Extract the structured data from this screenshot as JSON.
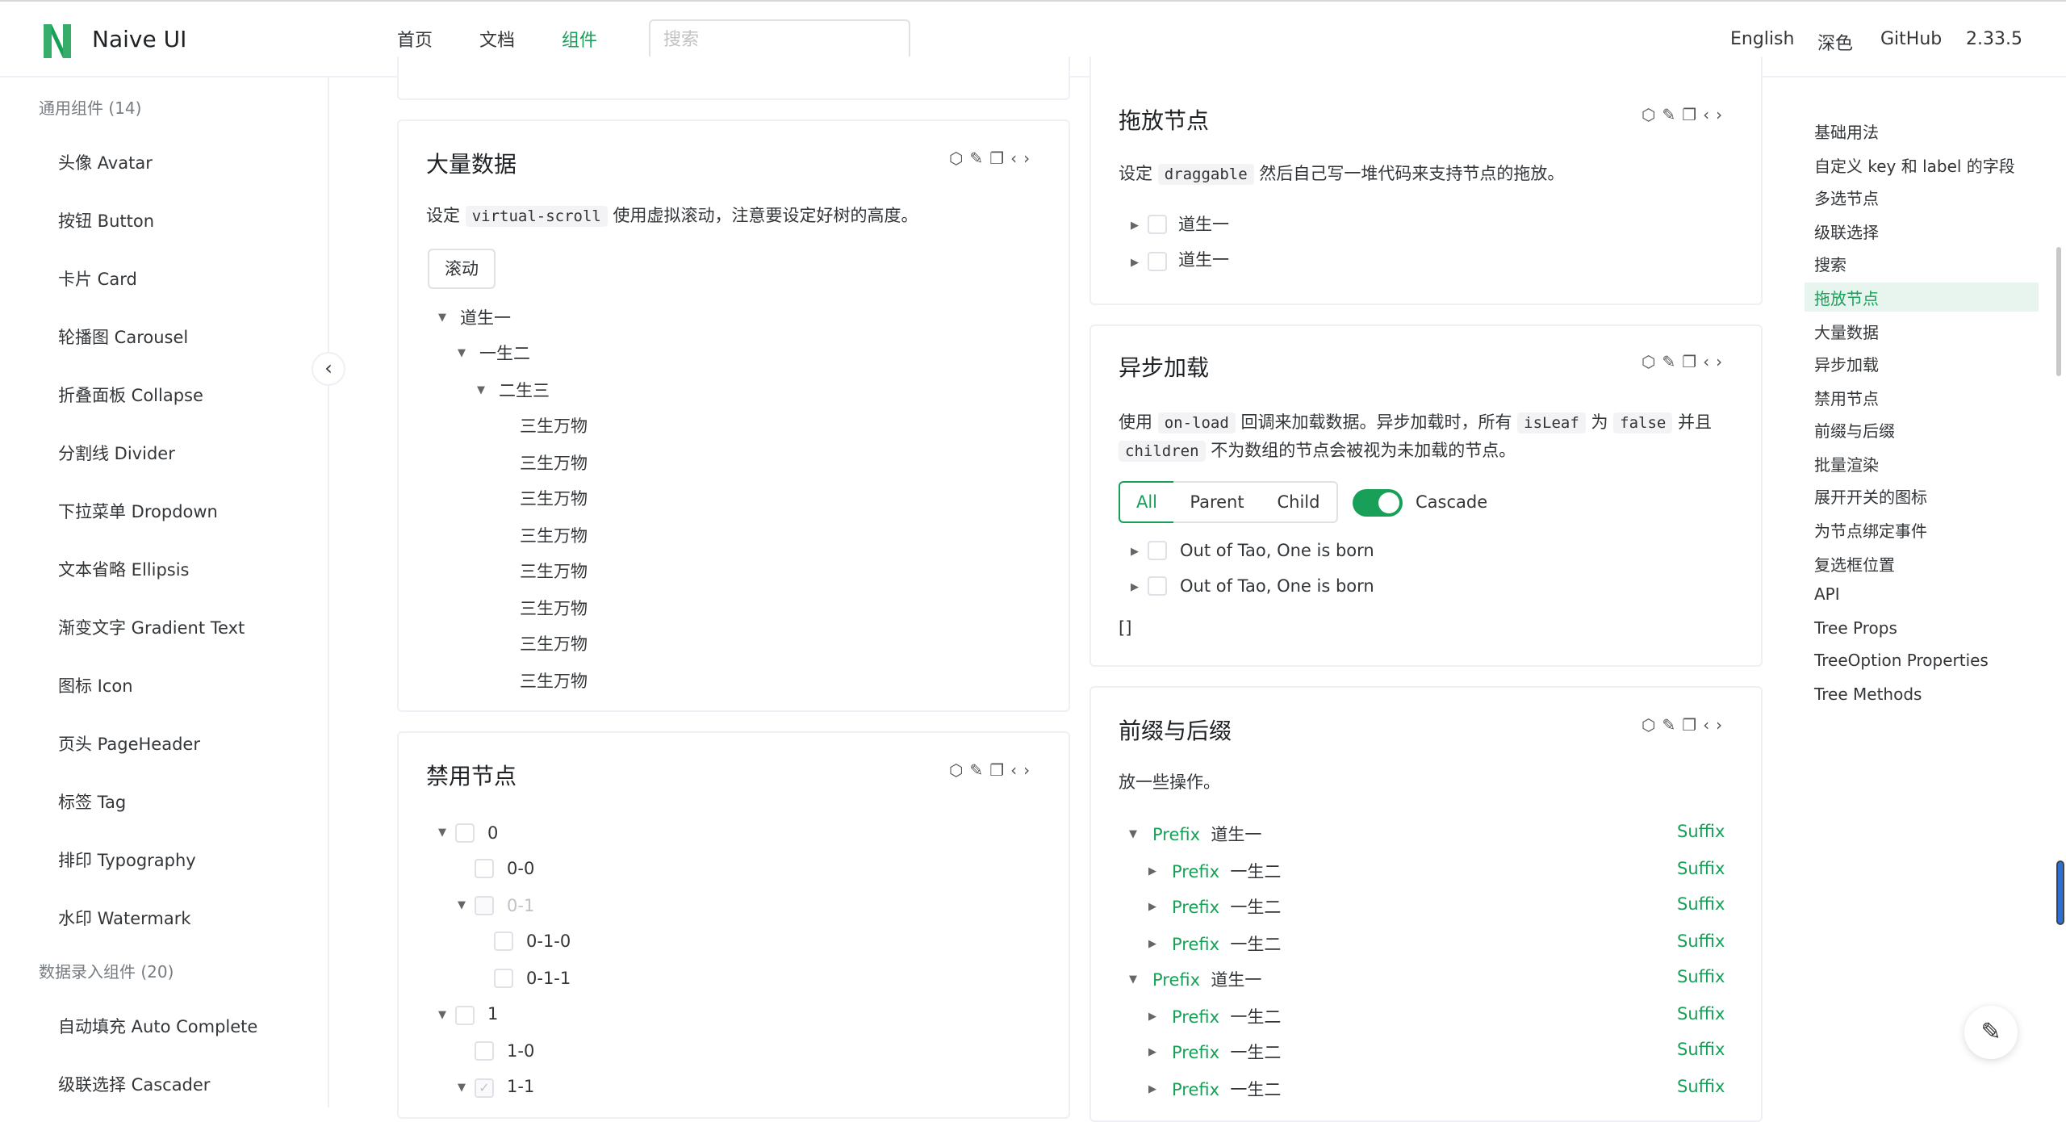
{
  "header": {
    "brand": "Naive UI",
    "nav": [
      "首页",
      "文档",
      "组件"
    ],
    "active_nav": "组件",
    "search_placeholder": "搜索",
    "right": [
      "English",
      "深色",
      "GitHub",
      "2.33.5"
    ]
  },
  "sidebar": {
    "group1": "通用组件 (14)",
    "items1": [
      "头像 Avatar",
      "按钮 Button",
      "卡片 Card",
      "轮播图 Carousel",
      "折叠面板 Collapse",
      "分割线 Divider",
      "下拉菜单 Dropdown",
      "文本省略 Ellipsis",
      "渐变文字 Gradient Text",
      "图标 Icon",
      "页头 PageHeader",
      "标签 Tag",
      "排印 Typography",
      "水印 Watermark"
    ],
    "group2": "数据录入组件 (20)",
    "items2": [
      "自动填充 Auto Complete",
      "级联选择 Cascader"
    ]
  },
  "big_data": {
    "title": "大量数据",
    "desc_prefix": "设定",
    "desc_code": "virtual-scroll",
    "desc_suffix": "使用虚拟滚动，注意要设定好树的高度。",
    "button": "滚动",
    "tree": [
      "道生一",
      "一生二",
      "二生三",
      "三生万物",
      "三生万物",
      "三生万物",
      "三生万物",
      "三生万物",
      "三生万物",
      "三生万物",
      "三生万物"
    ]
  },
  "disabled": {
    "title": "禁用节点",
    "tree": [
      "0",
      "0-0",
      "0-1",
      "0-1-0",
      "0-1-1",
      "1",
      "1-0",
      "1-1"
    ]
  },
  "drag": {
    "title": "拖放节点",
    "desc_prefix": "设定",
    "desc_code": "draggable",
    "desc_suffix": "然后自己写一堆代码来支持节点的拖放。",
    "tree": [
      "道生一",
      "道生一"
    ]
  },
  "async": {
    "title": "异步加载",
    "desc_1": "使用",
    "code_1": "on-load",
    "desc_2": "回调来加载数据。异步加载时，所有",
    "code_2": "isLeaf",
    "desc_3": "为",
    "code_3": "false",
    "desc_4": "并且",
    "code_4": "children",
    "desc_5": "不为数组的节点会被视为未加载的节点。",
    "segments": [
      "All",
      "Parent",
      "Child"
    ],
    "cascade_label": "Cascade",
    "tree": [
      "Out of Tao, One is born",
      "Out of Tao, One is born"
    ],
    "output": "[]"
  },
  "prefix_suffix": {
    "title": "前缀与后缀",
    "desc": "放一些操作。",
    "prefix": "Prefix",
    "suffix": "Suffix",
    "rows": [
      "道生一",
      "一生二",
      "一生二",
      "一生二",
      "道生一",
      "一生二",
      "一生二",
      "一生二"
    ]
  },
  "toc": [
    "基础用法",
    "自定义 key 和 label 的字段",
    "多选节点",
    "级联选择",
    "搜索",
    "拖放节点",
    "大量数据",
    "异步加载",
    "禁用节点",
    "前缀与后缀",
    "批量渲染",
    "展开开关的图标",
    "为节点绑定事件",
    "复选框位置",
    "API",
    "Tree Props",
    "TreeOption Properties",
    "Tree Methods"
  ],
  "toc_active": "拖放节点",
  "colors": {
    "accent": "#18a058",
    "border": "#efeff5"
  }
}
